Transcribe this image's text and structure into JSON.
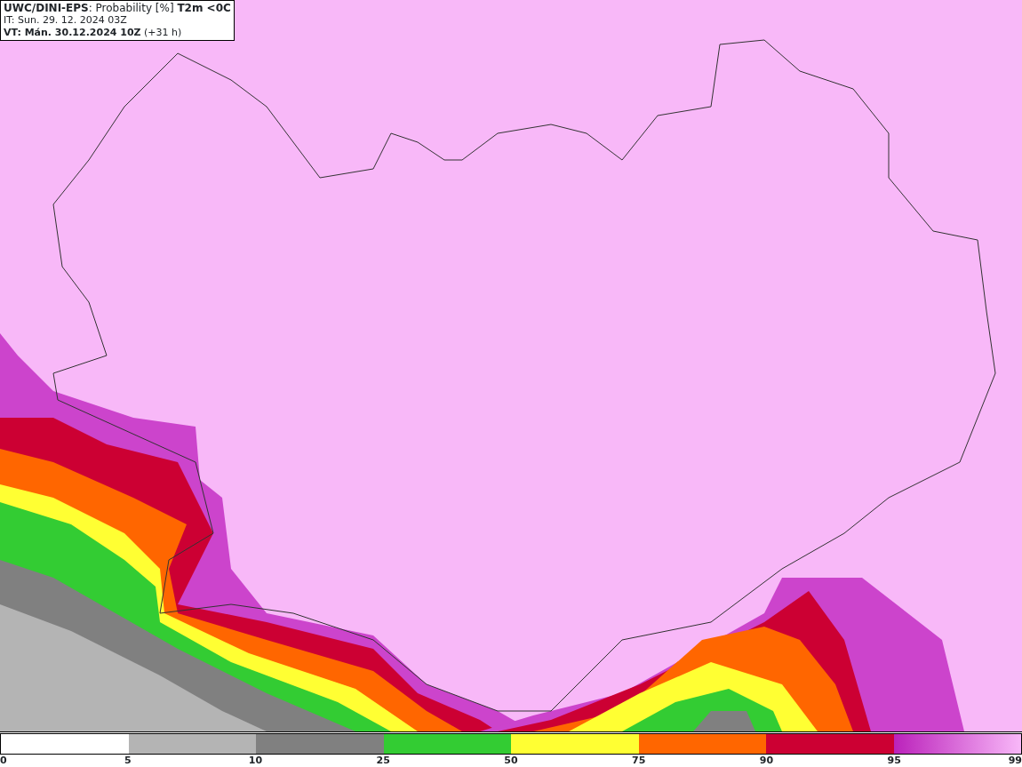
{
  "header": {
    "title": "**UWC/DINI-EPS**: Probability [%] **T2m <0C**",
    "issue_time": "IT: Sun. 29. 12. 2024 03Z",
    "valid_time": "**VT: Mán. 30.12.2024 10Z** (+31 h)"
  },
  "legend": {
    "bins": [
      {
        "label": "0"
      },
      {
        "label": "5"
      },
      {
        "label": "10"
      },
      {
        "label": "25"
      },
      {
        "label": "50"
      },
      {
        "label": "75"
      },
      {
        "label": "90"
      },
      {
        "label": "95"
      }
    ],
    "end_label": "99"
  }
}
